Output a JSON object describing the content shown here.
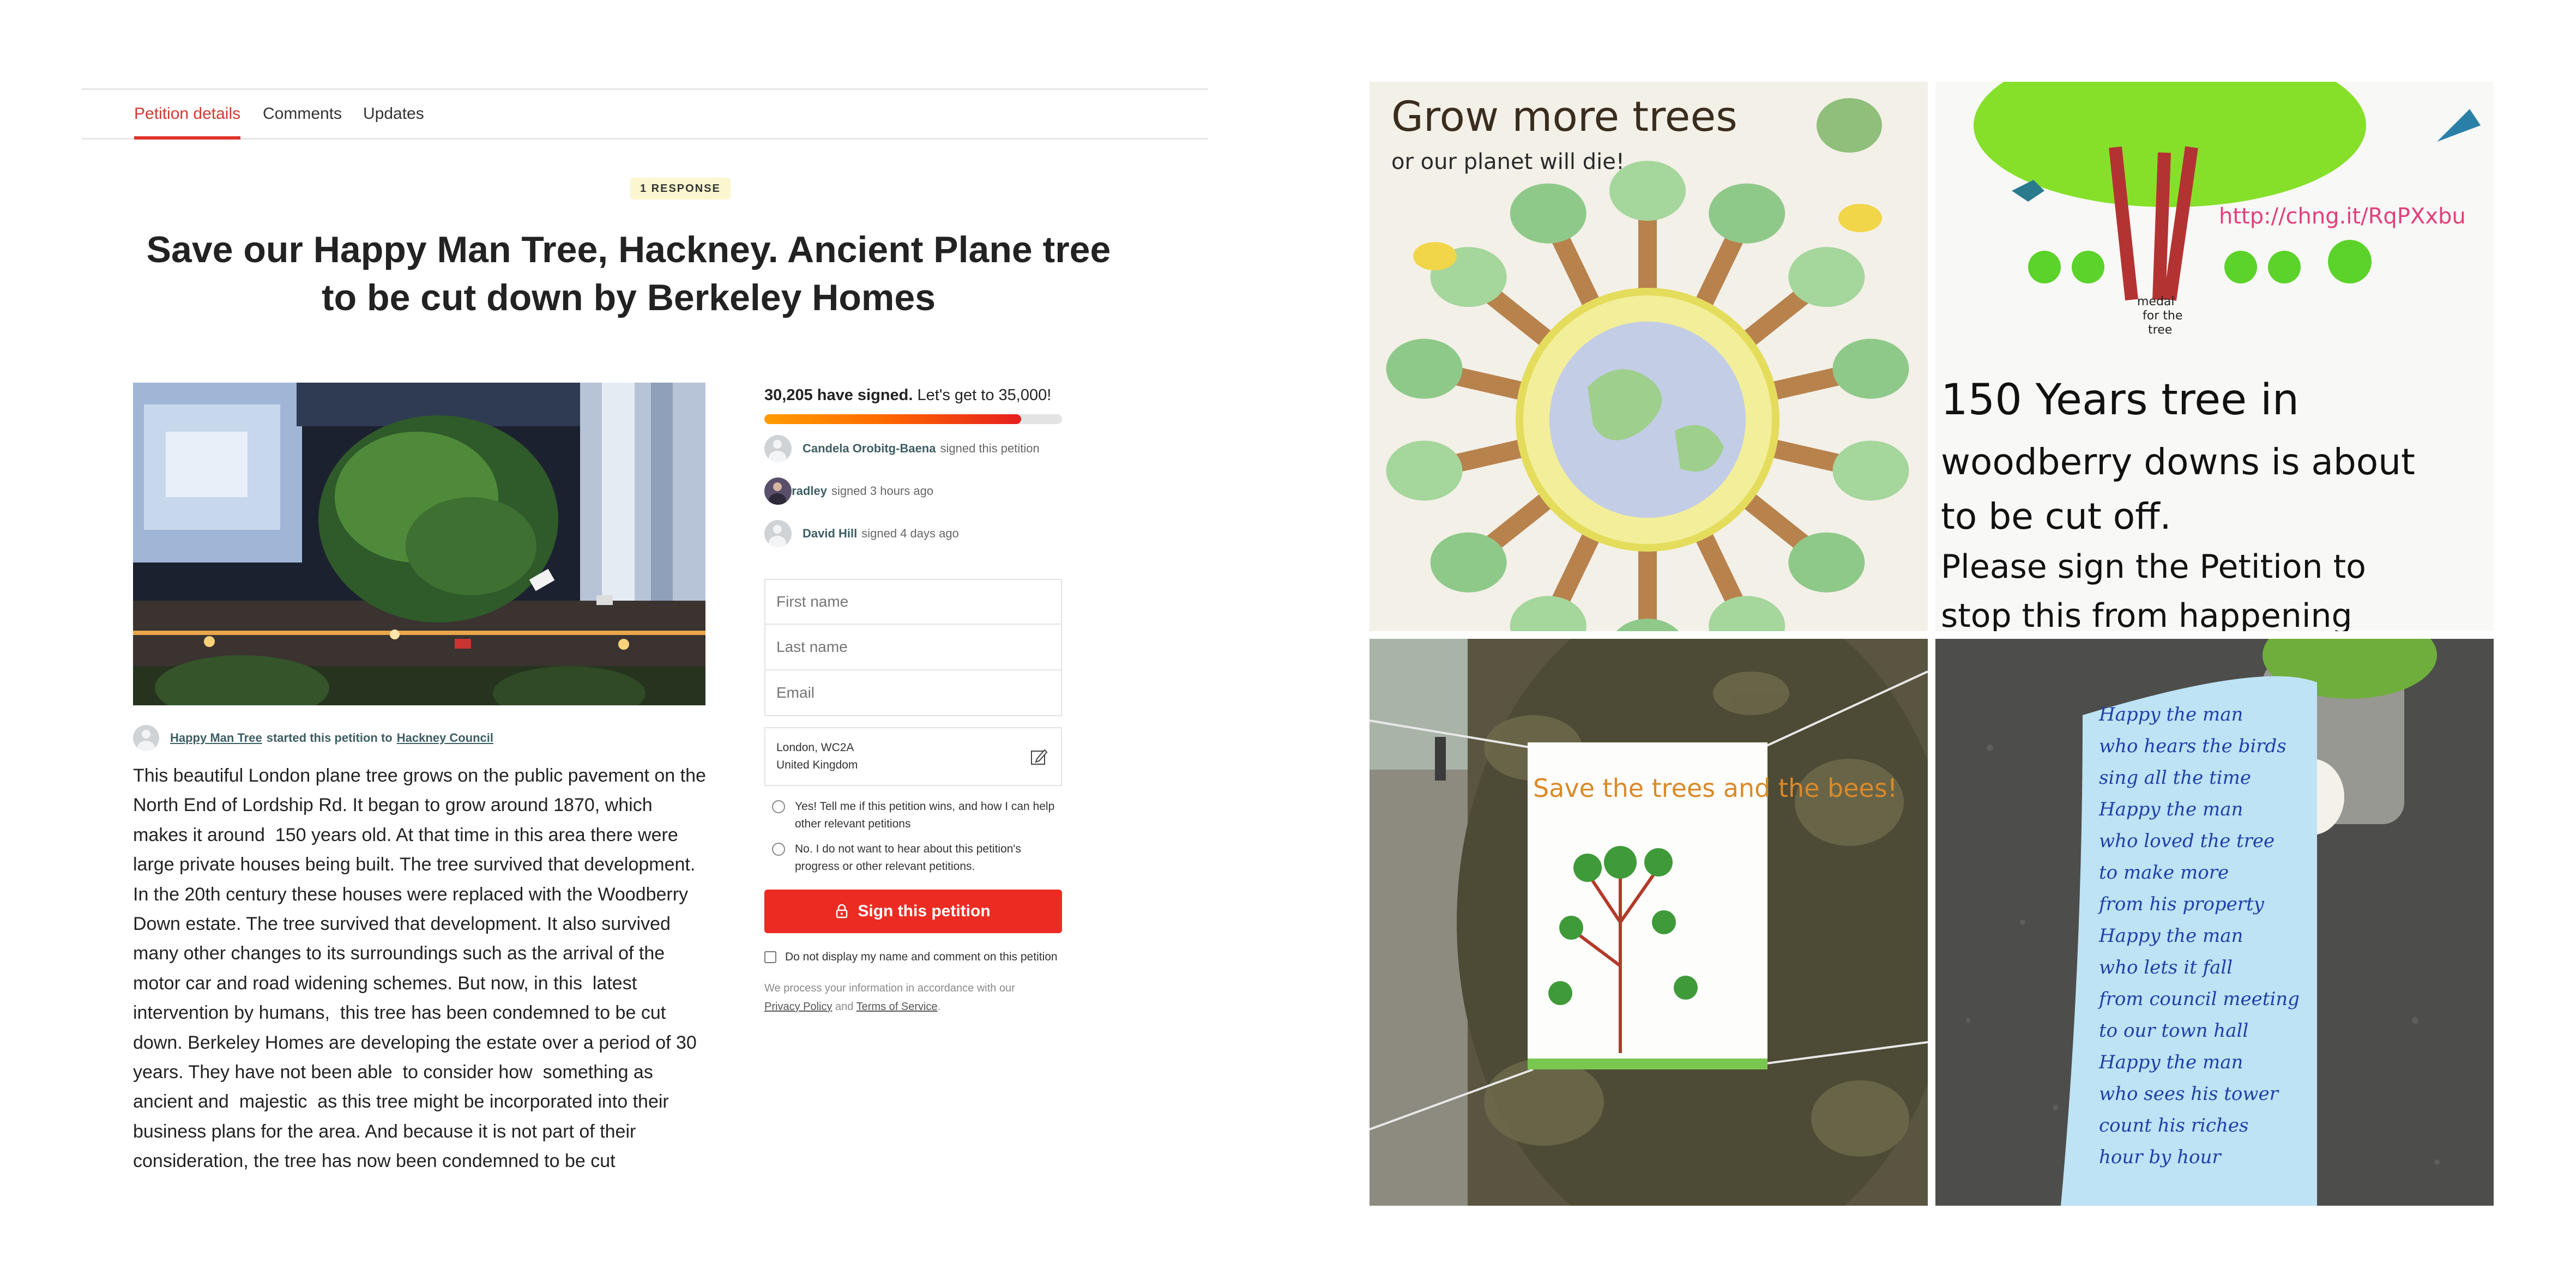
{
  "tabs": [
    "Petition details",
    "Comments",
    "Updates"
  ],
  "badge": "1 RESPONSE",
  "title": "Save our Happy Man Tree, Hackney. Ancient Plane tree to be cut down by Berkeley Homes",
  "starter": {
    "name": "Happy Man Tree",
    "action": "started this petition to",
    "target": "Hackney Council"
  },
  "description": "This beautiful London plane tree grows on the public pavement on the North End of Lordship Rd. It began to grow around 1870, which makes it around  150 years old. At that time in this area there were large private houses being built. The tree survived that development.  In the 20th century these houses were replaced with the Woodberry Down estate. The tree survived that development. It also survived  many other changes to its surroundings such as the arrival of the motor car and road widening schemes. But now, in this  latest intervention by humans,  this tree has been condemned to be cut down. Berkeley Homes are developing the estate over a period of 30 years. They have not been able  to consider how  something as ancient and  majestic  as this tree might be incorporated into their business plans for the area. And because it is not part of their consideration, the tree has now been condemned to be cut",
  "signatures": {
    "count_label": "30,205 have signed.",
    "goal_label": "Let's get to 35,000!",
    "progress": 0.863
  },
  "recent_signers": [
    {
      "name": "Candela Orobitg-Baena",
      "text": "signed this petition"
    },
    {
      "name": "Ali Bradley",
      "text": "signed 3 hours ago"
    },
    {
      "name": "David Hill",
      "text": "signed 4 days ago"
    }
  ],
  "form": {
    "first_name_placeholder": "First name",
    "last_name_placeholder": "Last name",
    "email_placeholder": "Email",
    "location_line1": "London, WC2A",
    "location_line2": "United Kingdom",
    "opt_in": "Yes! Tell me if this petition wins, and how I can help other relevant petitions",
    "opt_out": "No. I do not want to hear about this petition's progress or other relevant petitions.",
    "sign_button": "Sign this petition",
    "hide_name": "Do not display my name and comment on this petition",
    "privacy_prefix": "We process your information in accordance with our",
    "privacy_link": "Privacy Policy",
    "and": "and",
    "terms_link": "Terms of Service"
  },
  "photos": {
    "drawing1_line1": "Grow more trees",
    "drawing1_line2": "or our planet will die!",
    "drawing2_url": "http://chng.it/RqPXxbu",
    "drawing2_small": [
      "medal",
      "for the",
      "tree"
    ],
    "drawing2_lines": [
      "150 Years tree in",
      "woodberry downs is about",
      "to be cut off.",
      "Please sign the Petition to",
      "stop this from happening"
    ],
    "poster_text": "Save the trees and the bees!",
    "scroll_lines": [
      "Happy the man",
      "who hears the birds",
      "sing all the time",
      "Happy the man",
      "who loved the tree",
      "to make more",
      "from his property",
      "Happy the man",
      "who lets it fall",
      "from council meeting",
      "to our town hall",
      "Happy the man",
      "who sees his tower",
      "count his riches",
      "hour by hour"
    ]
  }
}
